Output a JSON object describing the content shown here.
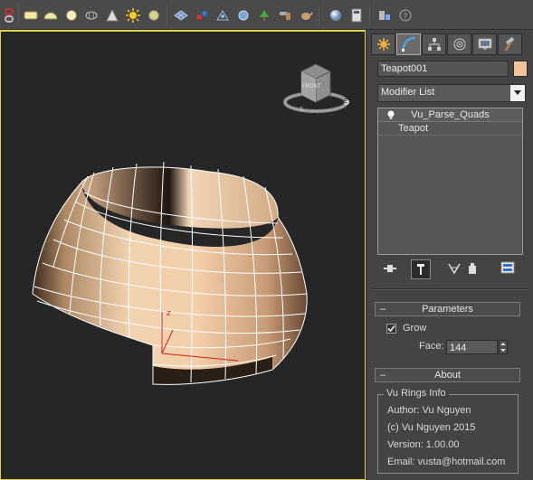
{
  "toolbar": {
    "icons": [
      "chain-link-icon",
      "box-primitive-icon",
      "sphere-flat-icon",
      "circle-icon",
      "torus-wire-icon",
      "cone-icon",
      "sun-icon",
      "disc-icon",
      "checker-grid-icon",
      "atom-icon",
      "grab-icon",
      "sparkle-icon",
      "tree-icon",
      "hammer-icon",
      "teapot-icon",
      "sphere-icon",
      "calculator-icon",
      "list-icon",
      "help-icon"
    ]
  },
  "viewport": {
    "viewcube_label": "FRONT",
    "compass": {
      "e": "E",
      "s": "S"
    }
  },
  "panel": {
    "tabs": [
      "create-tab",
      "modify-tab",
      "hierarchy-tab",
      "motion-tab",
      "display-tab",
      "utilities-tab"
    ],
    "object_name": "Teapot001",
    "object_color": "#f0c49a",
    "modifier_list": {
      "value": "Modifier List"
    },
    "stack": [
      {
        "label": "Vu_Parse_Quads",
        "selected": true
      },
      {
        "label": "Teapot",
        "selected": false
      }
    ],
    "parameters": {
      "title": "Parameters",
      "grow_label": "Grow",
      "grow_checked": true,
      "face_label": "Face:",
      "face_value": "144"
    },
    "about": {
      "title": "About",
      "group_title": "Vu Rings Info",
      "lines": [
        "Author: Vu Nguyen",
        "(c) Vu Nguyen 2015",
        "Version: 1.00.00",
        "Email: vusta@hotmail.com"
      ]
    }
  }
}
